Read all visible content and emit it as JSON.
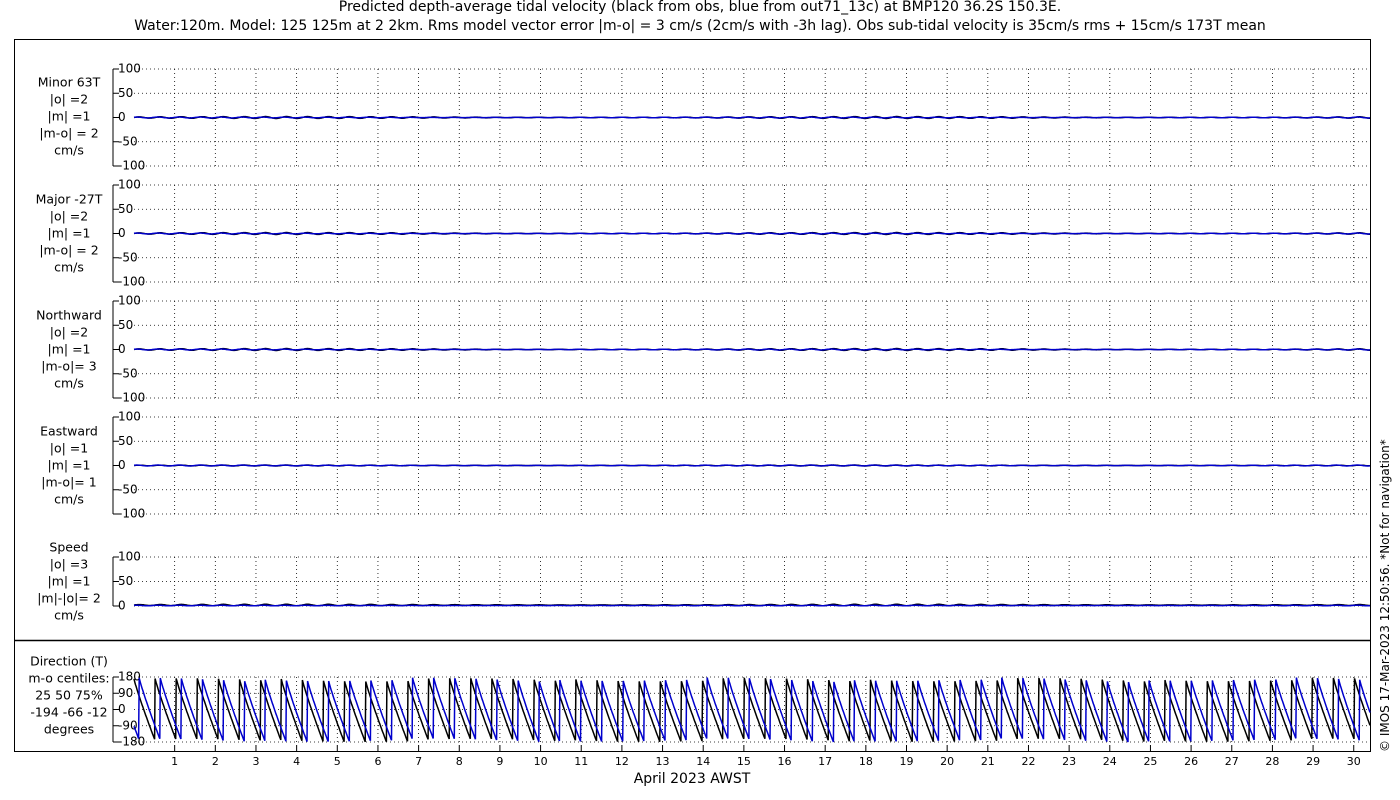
{
  "figure": {
    "title_line1": "Predicted depth-average tidal velocity (black from obs, blue from out71_13c) at BMP120 36.2S 150.3E.",
    "title_line2": "Water:120m. Model: 125 125m at 2 2km. Rms model vector error |m-o| = 3 cm/s (2cm/s with -3h lag). Obs sub-tidal velocity is 35cm/s rms + 15cm/s 173T mean",
    "xlabel": "April 2023 AWST",
    "copyright": "© IMOS 17-Mar-2023 12:50:56. *Not for navigation*",
    "colors": {
      "obs": "#000000",
      "model": "#0000cc",
      "grid": "#000000"
    }
  },
  "chart_data": [
    {
      "type": "line",
      "panel": "minor",
      "labels": [
        "Minor 63T",
        "|o| =2",
        "|m| =1",
        "|m-o| = 2",
        "cm/s"
      ],
      "yticks": [
        "100",
        "50",
        "0",
        "-50",
        "-100"
      ],
      "ylim": [
        -100,
        100
      ],
      "xlim": [
        0,
        30.4
      ],
      "series": [
        {
          "color": "#000000",
          "amplitude": 2,
          "mean": 0,
          "period_days": 0.5175
        },
        {
          "color": "#0000cc",
          "amplitude": 1,
          "mean": 0,
          "period_days": 0.5175
        }
      ]
    },
    {
      "type": "line",
      "panel": "major",
      "labels": [
        "Major -27T",
        "|o| =2",
        "|m| =1",
        "|m-o| = 2",
        "cm/s"
      ],
      "yticks": [
        "100",
        "50",
        "0",
        "-50",
        "-100"
      ],
      "ylim": [
        -100,
        100
      ],
      "xlim": [
        0,
        30.4
      ],
      "series": [
        {
          "color": "#000000",
          "amplitude": 2,
          "mean": 0,
          "period_days": 0.5175
        },
        {
          "color": "#0000cc",
          "amplitude": 1,
          "mean": 0,
          "period_days": 0.5175
        }
      ]
    },
    {
      "type": "line",
      "panel": "northward",
      "labels": [
        "Northward",
        "|o| =2",
        "|m| =1",
        "|m-o|= 3",
        "cm/s"
      ],
      "yticks": [
        "100",
        "50",
        "0",
        "-50",
        "-100"
      ],
      "ylim": [
        -100,
        100
      ],
      "xlim": [
        0,
        30.4
      ],
      "series": [
        {
          "color": "#000000",
          "amplitude": 2,
          "mean": 0,
          "period_days": 0.5175
        },
        {
          "color": "#0000cc",
          "amplitude": 1,
          "mean": 0,
          "period_days": 0.5175
        }
      ]
    },
    {
      "type": "line",
      "panel": "eastward",
      "labels": [
        "Eastward",
        "|o| =1",
        "|m| =1",
        "|m-o|= 1",
        "cm/s"
      ],
      "yticks": [
        "100",
        "50",
        "0",
        "-50",
        "-100"
      ],
      "ylim": [
        -100,
        100
      ],
      "xlim": [
        0,
        30.4
      ],
      "series": [
        {
          "color": "#000000",
          "amplitude": 1,
          "mean": 0,
          "period_days": 0.5175
        },
        {
          "color": "#0000cc",
          "amplitude": 1,
          "mean": 0,
          "period_days": 0.5175
        }
      ]
    },
    {
      "type": "line",
      "panel": "speed",
      "labels": [
        "Speed",
        "|o| =3",
        "|m| =1",
        "|m|-|o|= 2",
        "cm/s"
      ],
      "yticks": [
        "100",
        "50",
        "0"
      ],
      "ylim": [
        0,
        100
      ],
      "xlim": [
        0,
        30.4
      ],
      "series": [
        {
          "color": "#000000",
          "amplitude": 1.5,
          "mean": 2,
          "period_days": 0.5175
        },
        {
          "color": "#0000cc",
          "amplitude": 0.5,
          "mean": 1,
          "period_days": 0.5175
        }
      ]
    },
    {
      "type": "line",
      "panel": "direction",
      "labels": [
        "Direction (T)",
        "m-o centiles:",
        "25  50  75%",
        "-194  -66  -12",
        "degrees"
      ],
      "yticks": [
        "180",
        "90",
        "0",
        "-90",
        "-180"
      ],
      "ylim": [
        -180,
        180
      ],
      "xlim": [
        0,
        30.4
      ],
      "series": [
        {
          "color": "#000000",
          "period_days": 0.5175,
          "phase_days": 0.0
        },
        {
          "color": "#0000cc",
          "period_days": 0.5175,
          "phase_days": 0.125
        }
      ]
    }
  ],
  "xaxis": {
    "ticks": [
      1,
      2,
      3,
      4,
      5,
      6,
      7,
      8,
      9,
      10,
      11,
      12,
      13,
      14,
      15,
      16,
      17,
      18,
      19,
      20,
      21,
      22,
      23,
      24,
      25,
      26,
      27,
      28,
      29,
      30
    ],
    "tick_labels": [
      "1",
      "2",
      "3",
      "4",
      "5",
      "6",
      "7",
      "8",
      "9",
      "10",
      "11",
      "12",
      "13",
      "14",
      "15",
      "16",
      "17",
      "18",
      "19",
      "20",
      "21",
      "22",
      "23",
      "24",
      "25",
      "26",
      "27",
      "28",
      "29",
      "30"
    ]
  }
}
